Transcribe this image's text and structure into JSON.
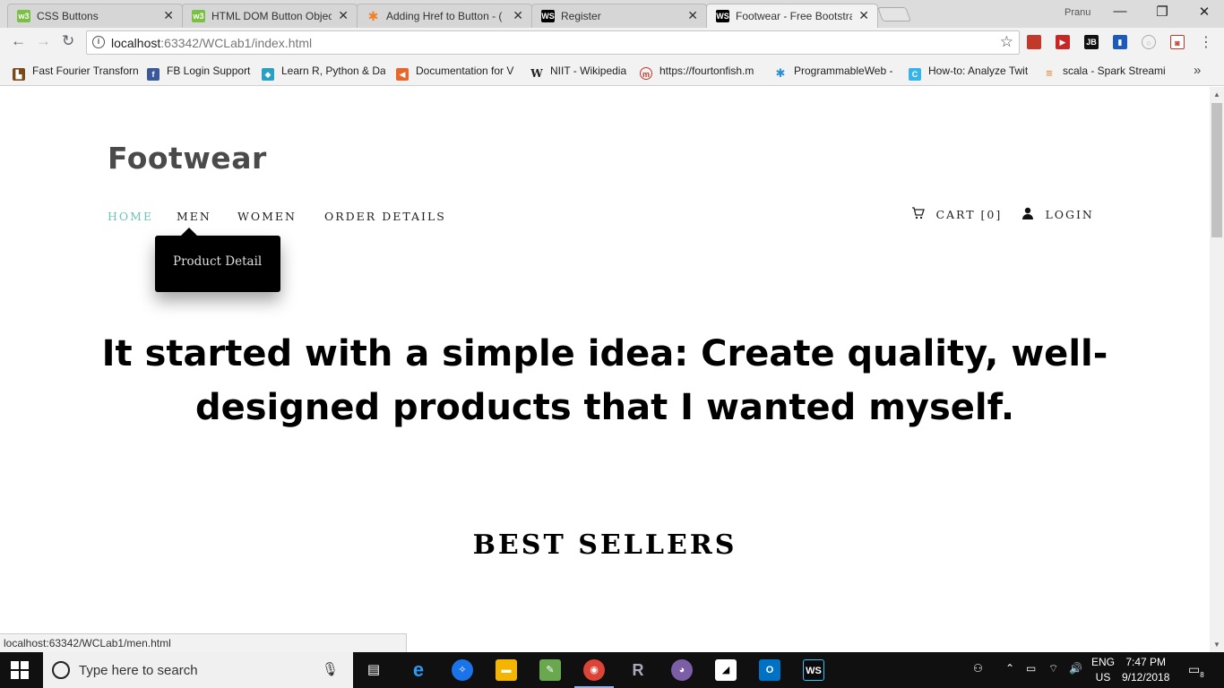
{
  "browser": {
    "tabs": [
      {
        "title": "CSS Buttons",
        "favicon": "w3schools-icon",
        "fav_text": "w3",
        "fav_color": "#7ac143"
      },
      {
        "title": "HTML DOM Button Objec",
        "favicon": "w3schools-icon",
        "fav_text": "w3",
        "fav_color": "#7ac143"
      },
      {
        "title": "Adding Href to Button - (",
        "favicon": "asterisk-icon",
        "fav_text": "✱",
        "fav_color": "#f48024"
      },
      {
        "title": "Register",
        "favicon": "webstorm-icon",
        "fav_text": "WS",
        "fav_color": "#000000"
      },
      {
        "title": "Footwear - Free Bootstra",
        "favicon": "webstorm-icon",
        "fav_text": "WS",
        "fav_color": "#000000"
      }
    ],
    "profile_name": "Pranu",
    "url_host": "localhost",
    "url_rest": ":63342/WCLab1/index.html",
    "bookmarks": [
      {
        "label": "Fast Fourier Transforn",
        "icon": "bookmark-page-icon",
        "icon_text": "▙",
        "color": "#7a4a1a"
      },
      {
        "label": "FB Login Support",
        "icon": "facebook-icon",
        "icon_text": "f",
        "color": "#3b5998"
      },
      {
        "label": "Learn R, Python & Da",
        "icon": "shield-icon",
        "icon_text": "◆",
        "color": "#27a0c4"
      },
      {
        "label": "Documentation for V",
        "icon": "visual-studio-icon",
        "icon_text": "◀",
        "color": "#e8662a"
      },
      {
        "label": "NIIT - Wikipedia",
        "icon": "wikipedia-icon",
        "icon_text": "W",
        "color": "#555555"
      },
      {
        "label": "https://fourtonfish.m",
        "icon": "m-icon",
        "icon_text": "m",
        "color": "#c0392b"
      },
      {
        "label": "ProgrammableWeb -",
        "icon": "puzzle-icon",
        "icon_text": "✱",
        "color": "#2a8fd4"
      },
      {
        "label": "How-to: Analyze Twit",
        "icon": "c-icon",
        "icon_text": "C",
        "color": "#36b3e8"
      },
      {
        "label": "scala - Spark Streami",
        "icon": "stackoverflow-icon",
        "icon_text": "≡",
        "color": "#f48024"
      }
    ]
  },
  "site": {
    "logo": "Footwear",
    "nav": {
      "home": "HOME",
      "men": "MEN",
      "women": "WOMEN",
      "order_details": "ORDER DETAILS",
      "cart": "CART [0]",
      "login": "LOGIN"
    },
    "dropdown_item": "Product Detail",
    "hero_line1": "It started with a simple idea: Create quality, well-",
    "hero_line2": "designed products that I wanted myself.",
    "section_title": "BEST SELLERS",
    "colors": {
      "accent": "#6cc3b9",
      "logo": "#4a4a4a"
    }
  },
  "status_url": "localhost:63342/WCLab1/men.html",
  "taskbar": {
    "search_placeholder": "Type here to search",
    "lang_top": "ENG",
    "lang_bottom": "US",
    "time": "7:47 PM",
    "date": "9/12/2018",
    "notification_count": "8"
  }
}
